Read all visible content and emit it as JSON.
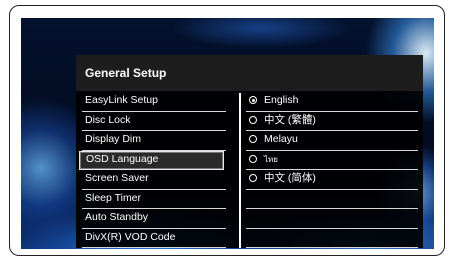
{
  "panel": {
    "title": "General Setup"
  },
  "menu": {
    "items": [
      {
        "label": "EasyLink Setup",
        "selected": false
      },
      {
        "label": "Disc Lock",
        "selected": false
      },
      {
        "label": "Display Dim",
        "selected": false
      },
      {
        "label": "OSD Language",
        "selected": true
      },
      {
        "label": "Screen Saver",
        "selected": false
      },
      {
        "label": "Sleep Timer",
        "selected": false
      },
      {
        "label": "Auto Standby",
        "selected": false
      },
      {
        "label": "DivX(R) VOD Code",
        "selected": false
      }
    ]
  },
  "options": {
    "selected_index": 0,
    "items": [
      {
        "label": "English",
        "checked": true
      },
      {
        "label": "中文 (繁體)",
        "checked": false
      },
      {
        "label": "Melayu",
        "checked": false
      },
      {
        "label": "ไทย",
        "checked": false
      },
      {
        "label": "中文 (简体)",
        "checked": false
      },
      {
        "label": "",
        "checked": false,
        "empty": true
      },
      {
        "label": "",
        "checked": false,
        "empty": true
      },
      {
        "label": "",
        "checked": false,
        "empty": true
      }
    ]
  },
  "colors": {
    "panel_background": "#000000",
    "text": "#ffffff",
    "highlight_border": "#e8e8e8",
    "background_glow": "#3c8cf0"
  }
}
